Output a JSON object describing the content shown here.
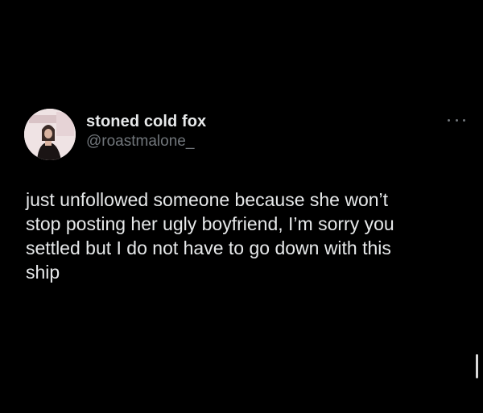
{
  "tweet": {
    "author": {
      "display_name": "stoned cold fox",
      "handle": "@roastmalone_"
    },
    "text_lines": [
      "just unfollowed someone because she won’t",
      "stop posting her ugly boyfriend, I’m sorry you",
      "settled but I do not have to go down with this",
      "ship"
    ]
  },
  "icons": {
    "more": "more-horizontal-icon"
  },
  "colors": {
    "background": "#000000",
    "primary_text": "#e7e9ea",
    "secondary_text": "#71767b"
  }
}
